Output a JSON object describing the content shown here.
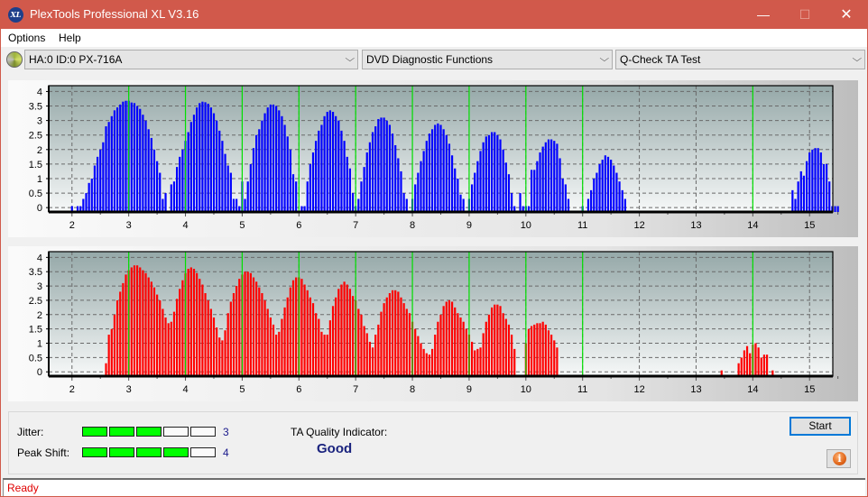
{
  "window": {
    "title": "PlexTools Professional XL V3.16",
    "app_icon": "XL",
    "minimize_icon": "—",
    "maximize_icon": "☐",
    "close_icon": "✕"
  },
  "menu": {
    "items": [
      {
        "label": "Options"
      },
      {
        "label": "Help"
      }
    ]
  },
  "toolbar": {
    "drive_select": {
      "value": "HA:0 ID:0  PX-716A"
    },
    "function_select": {
      "value": "DVD Diagnostic Functions"
    },
    "test_select": {
      "value": "Q-Check TA Test"
    },
    "chevron": "⌵"
  },
  "results": {
    "jitter_label": "Jitter:",
    "jitter_value": "3",
    "jitter_level": 3,
    "peak_shift_label": "Peak Shift:",
    "peak_shift_value": "4",
    "peak_shift_level": 4,
    "meter_segments": 5,
    "quality_label": "TA Quality Indicator:",
    "quality_value": "Good"
  },
  "buttons": {
    "start_label": "Start",
    "info_icon": "i"
  },
  "status": {
    "text": "Ready"
  },
  "colors": {
    "top_bars": "#0000ff",
    "bottom_bars": "#ff0000",
    "marker_lines": "#00e000",
    "meter_on": "#00ff00"
  },
  "chart_data": [
    {
      "type": "bar",
      "name": "top-chart",
      "series_color": "#0000ff",
      "xlim": [
        1.59,
        15.41
      ],
      "ylim": [
        -0.15,
        4.2
      ],
      "xticks": [
        "2",
        "3",
        "4",
        "5",
        "6",
        "7",
        "8",
        "9",
        "10",
        "11",
        "12",
        "13",
        "14",
        "15"
      ],
      "yticks": [
        "0",
        "0.5",
        "1",
        "1.5",
        "2",
        "2.5",
        "3",
        "3.5",
        "4"
      ],
      "marker_lines_x": [
        3,
        4,
        5,
        6,
        7,
        8,
        9,
        10,
        11,
        14
      ],
      "grid": true,
      "x_start": 1.65,
      "x_step": 0.05,
      "values": [
        0,
        0,
        0,
        0,
        0,
        0,
        0,
        0.05,
        0,
        0.05,
        0.05,
        0.3,
        0.5,
        0.85,
        1.0,
        1.45,
        1.75,
        2.0,
        2.25,
        2.8,
        2.95,
        3.15,
        3.35,
        3.45,
        3.55,
        3.65,
        3.68,
        3.68,
        3.62,
        3.6,
        3.5,
        3.4,
        3.2,
        3.0,
        2.7,
        2.4,
        2.0,
        1.6,
        1.2,
        0.3,
        0.5,
        0,
        0.8,
        0.9,
        1.4,
        1.75,
        2.0,
        2.3,
        2.6,
        2.95,
        3.2,
        3.45,
        3.6,
        3.65,
        3.63,
        3.58,
        3.45,
        3.25,
        3.0,
        2.65,
        2.3,
        1.85,
        1.45,
        1.2,
        0.3,
        0.3,
        0.05,
        0.9,
        0.3,
        0.9,
        1.5,
        2.05,
        2.5,
        2.7,
        3.0,
        3.25,
        3.45,
        3.55,
        3.55,
        3.5,
        3.35,
        3.15,
        2.85,
        2.45,
        2.0,
        1.15,
        0.9,
        0,
        0.05,
        0.05,
        0.9,
        1.5,
        1.9,
        2.3,
        2.65,
        2.85,
        3.15,
        3.3,
        3.35,
        3.3,
        3.15,
        3.0,
        2.65,
        2.3,
        1.75,
        1.35,
        0.5,
        0.05,
        0.3,
        0.9,
        1.4,
        1.9,
        2.25,
        2.6,
        2.8,
        3.05,
        3.1,
        3.1,
        3.0,
        2.85,
        2.55,
        2.15,
        1.7,
        1.25,
        0.5,
        0.3,
        0,
        0.3,
        0.8,
        1.2,
        1.6,
        1.95,
        2.3,
        2.55,
        2.7,
        2.85,
        2.9,
        2.85,
        2.7,
        2.5,
        2.2,
        1.8,
        1.35,
        1.0,
        0.45,
        0.3,
        0,
        0.3,
        0.8,
        1.2,
        1.6,
        1.95,
        2.25,
        2.45,
        2.5,
        2.6,
        2.6,
        2.5,
        2.35,
        2.0,
        1.55,
        1.15,
        0.5,
        0.05,
        0,
        0.5,
        0.05,
        0.05,
        0.05,
        1.3,
        1.3,
        1.6,
        1.9,
        2.1,
        2.25,
        2.35,
        2.35,
        2.3,
        2.2,
        1.7,
        1.0,
        0.8,
        0.3,
        0,
        0,
        0,
        0,
        0.05,
        0,
        0.3,
        0.6,
        1.0,
        1.2,
        1.5,
        1.65,
        1.8,
        1.75,
        1.65,
        1.45,
        1.2,
        0.9,
        0.6,
        0.3,
        0,
        0,
        0,
        0,
        0,
        0,
        0,
        0,
        0,
        0,
        0,
        0,
        0,
        0,
        0,
        0,
        0,
        0,
        0,
        0,
        0,
        0,
        0,
        0,
        0,
        0,
        0,
        0,
        0,
        0,
        0,
        0,
        0,
        0,
        0,
        0,
        0,
        0,
        0,
        0,
        0,
        0,
        0,
        0,
        0,
        0,
        0,
        0,
        0,
        0,
        0,
        0,
        0,
        0,
        0,
        0,
        0,
        0,
        0.6,
        0.3,
        0.9,
        1.25,
        1.1,
        1.6,
        1.9,
        2.0,
        2.05,
        2.05,
        1.9,
        1.5,
        1.5,
        0.9,
        0.05,
        0.05,
        0.05,
        0
      ]
    },
    {
      "type": "bar",
      "name": "bottom-chart",
      "series_color": "#ff0000",
      "xlim": [
        1.59,
        15.41
      ],
      "ylim": [
        -0.15,
        4.2
      ],
      "xticks": [
        "2",
        "3",
        "4",
        "5",
        "6",
        "7",
        "8",
        "9",
        "10",
        "11",
        "12",
        "13",
        "14",
        "15"
      ],
      "yticks": [
        "0",
        "0.5",
        "1",
        "1.5",
        "2",
        "2.5",
        "3",
        "3.5",
        "4"
      ],
      "marker_lines_x": [
        3,
        4,
        5,
        6,
        7,
        8,
        9,
        10,
        11,
        14
      ],
      "grid": true,
      "x_start": 1.65,
      "x_step": 0.05,
      "values": [
        0,
        0,
        0,
        0,
        0,
        0,
        0,
        0,
        0,
        0,
        0,
        0,
        0,
        0,
        0,
        0,
        0,
        0,
        0,
        0.3,
        1.3,
        1.5,
        2.0,
        2.5,
        2.8,
        3.1,
        3.4,
        3.55,
        3.65,
        3.72,
        3.72,
        3.65,
        3.55,
        3.45,
        3.3,
        3.15,
        2.95,
        2.7,
        2.5,
        2.2,
        1.9,
        1.7,
        1.75,
        2.1,
        2.55,
        2.9,
        3.2,
        3.45,
        3.6,
        3.65,
        3.6,
        3.45,
        3.25,
        3.05,
        2.75,
        2.5,
        2.2,
        1.9,
        1.55,
        1.2,
        1.1,
        1.45,
        2.05,
        2.45,
        2.75,
        3.0,
        3.25,
        3.4,
        3.5,
        3.5,
        3.45,
        3.3,
        3.15,
        2.95,
        2.75,
        2.5,
        2.2,
        1.9,
        1.65,
        1.3,
        1.4,
        1.85,
        2.25,
        2.6,
        2.95,
        3.2,
        3.3,
        3.3,
        3.25,
        3.05,
        2.85,
        2.6,
        2.4,
        2.05,
        1.85,
        1.4,
        1.3,
        1.3,
        1.8,
        2.3,
        2.6,
        2.9,
        3.05,
        3.15,
        3.05,
        2.9,
        2.65,
        2.5,
        2.2,
        2.0,
        1.6,
        1.35,
        1.05,
        0.85,
        1.3,
        1.65,
        2.1,
        2.4,
        2.6,
        2.75,
        2.85,
        2.85,
        2.8,
        2.6,
        2.4,
        2.2,
        2.05,
        1.75,
        1.5,
        1.25,
        1.0,
        0.8,
        0.65,
        0.6,
        0.8,
        1.3,
        1.75,
        2.0,
        2.3,
        2.45,
        2.5,
        2.45,
        2.25,
        2.05,
        1.9,
        1.75,
        1.5,
        1.3,
        1.05,
        0.75,
        0.8,
        0.85,
        1.35,
        1.75,
        2.0,
        2.25,
        2.35,
        2.35,
        2.3,
        2.05,
        1.85,
        1.65,
        1.3,
        0.8,
        0,
        0,
        0,
        1.0,
        1.5,
        1.6,
        1.65,
        1.7,
        1.7,
        1.75,
        1.65,
        1.45,
        1.3,
        1.1,
        0.85,
        0,
        0,
        0,
        0,
        0,
        0,
        0,
        0,
        0,
        0,
        0,
        0,
        0,
        0,
        0,
        0,
        0,
        0,
        0,
        0,
        0,
        0,
        0,
        0,
        0,
        0,
        0,
        0,
        0,
        0,
        0,
        0,
        0,
        0,
        0,
        0,
        0,
        0,
        0,
        0,
        0,
        0,
        0,
        0,
        0,
        0,
        0,
        0,
        0,
        0,
        0,
        0,
        0,
        0,
        0,
        0,
        0,
        0.05,
        0,
        0,
        0,
        0,
        0,
        0.3,
        0.5,
        0.75,
        0.9,
        0.65,
        0.95,
        1.0,
        0.85,
        0.5,
        0.6,
        0.6,
        0,
        0.05,
        0
      ]
    }
  ]
}
